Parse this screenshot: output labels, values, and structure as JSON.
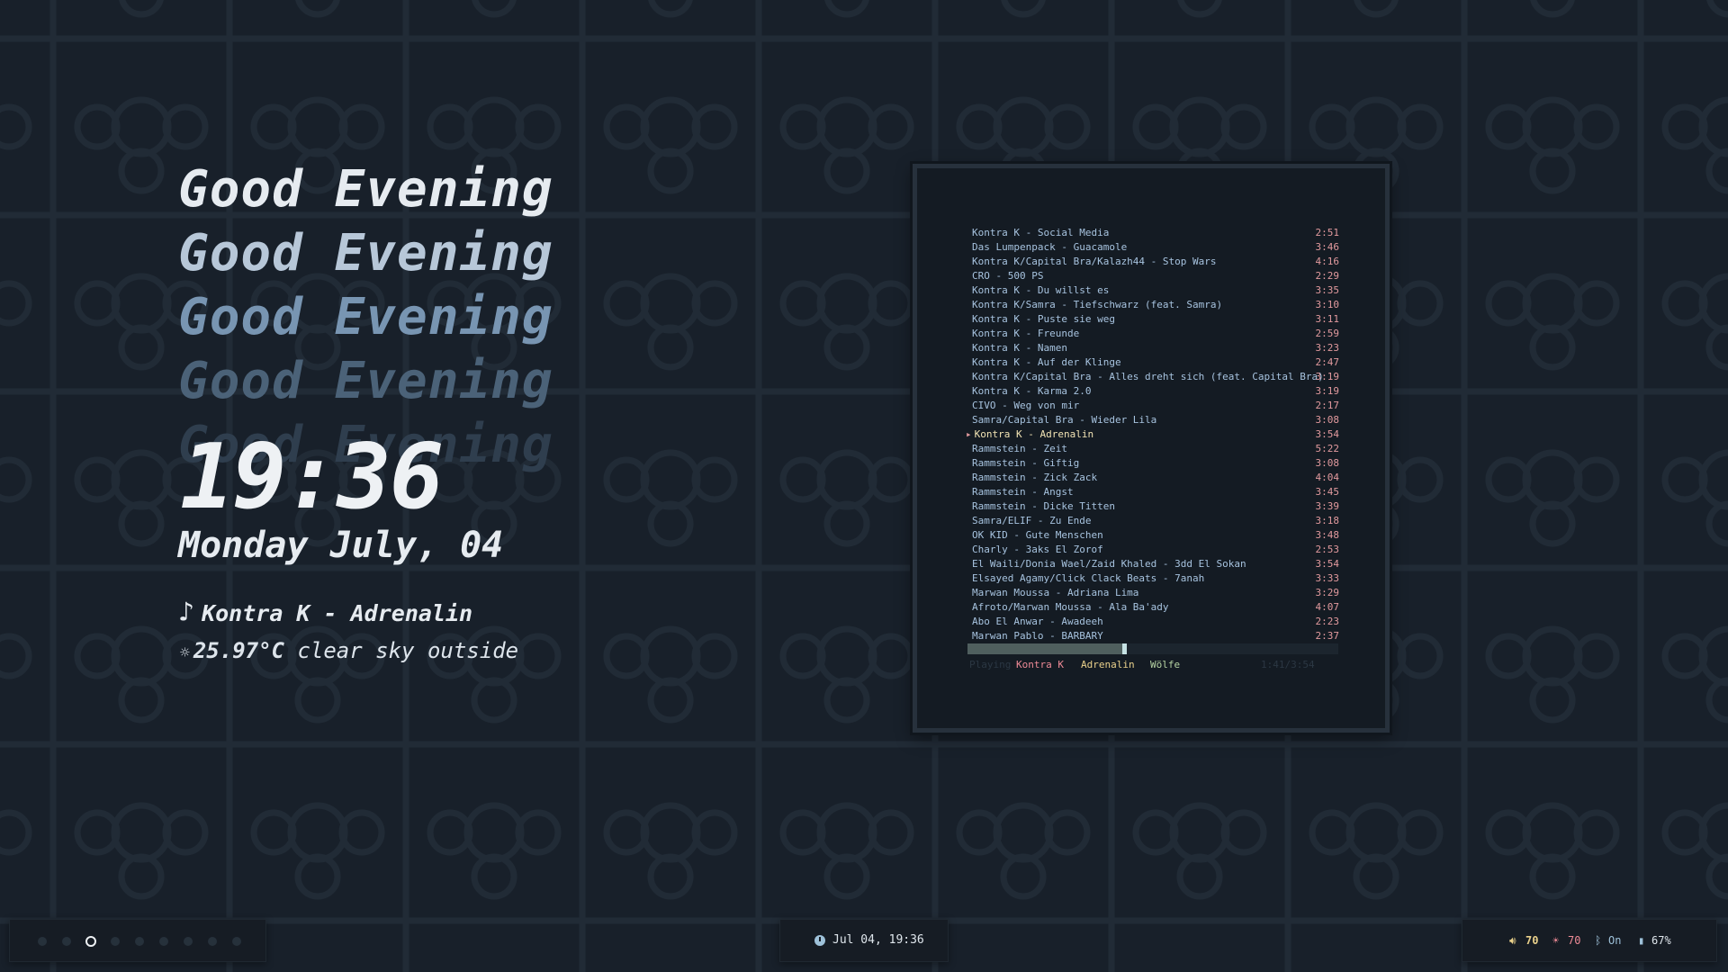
{
  "greeting": {
    "lines": [
      "Good Evening",
      "Good Evening",
      "Good Evening",
      "Good Evening",
      "Good Evening"
    ]
  },
  "clock": {
    "time": "19:36",
    "date": "Monday July, 04"
  },
  "now_playing": {
    "icon": "music-note-icon",
    "note_glyph": "♪",
    "text": "Kontra K - Adrenalin"
  },
  "weather": {
    "icon": "sun-icon",
    "icon_glyph": "☼",
    "temperature": "25.97°C",
    "description": "clear sky outside"
  },
  "player": {
    "tracks": [
      {
        "title": "Kontra K - Social Media",
        "duration": "2:51"
      },
      {
        "title": "Das Lumpenpack - Guacamole",
        "duration": "3:46"
      },
      {
        "title": "Kontra K/Capital Bra/Kalazh44 - Stop Wars",
        "duration": "4:16"
      },
      {
        "title": "CRO - 500 PS",
        "duration": "2:29"
      },
      {
        "title": "Kontra K - Du willst es",
        "duration": "3:35"
      },
      {
        "title": "Kontra K/Samra - Tiefschwarz (feat. Samra)",
        "duration": "3:10"
      },
      {
        "title": "Kontra K - Puste sie weg",
        "duration": "3:11"
      },
      {
        "title": "Kontra K - Freunde",
        "duration": "2:59"
      },
      {
        "title": "Kontra K - Namen",
        "duration": "3:23"
      },
      {
        "title": "Kontra K - Auf der Klinge",
        "duration": "2:47"
      },
      {
        "title": "Kontra K/Capital Bra - Alles dreht sich (feat. Capital Bra)",
        "duration": "3:19"
      },
      {
        "title": "Kontra K - Karma 2.0",
        "duration": "3:19"
      },
      {
        "title": "CIVO - Weg von mir",
        "duration": "2:17"
      },
      {
        "title": "Samra/Capital Bra - Wieder Lila",
        "duration": "3:08"
      },
      {
        "title": "Kontra K - Adrenalin",
        "duration": "3:54",
        "current": true
      },
      {
        "title": "Rammstein - Zeit",
        "duration": "5:22"
      },
      {
        "title": "Rammstein - Giftig",
        "duration": "3:08"
      },
      {
        "title": "Rammstein - Zick Zack",
        "duration": "4:04"
      },
      {
        "title": "Rammstein - Angst",
        "duration": "3:45"
      },
      {
        "title": "Rammstein - Dicke Titten",
        "duration": "3:39"
      },
      {
        "title": "Samra/ELIF - Zu Ende",
        "duration": "3:18"
      },
      {
        "title": "OK KID - Gute Menschen",
        "duration": "3:48"
      },
      {
        "title": "Charly - 3aks El Zorof",
        "duration": "2:53"
      },
      {
        "title": "El Waili/Donia Wael/Zaid Khaled - 3dd El Sokan",
        "duration": "3:54"
      },
      {
        "title": "Elsayed Agamy/Click Clack Beats - 7anah",
        "duration": "3:33"
      },
      {
        "title": "Marwan Moussa - Adriana Lima",
        "duration": "3:29"
      },
      {
        "title": "Afroto/Marwan Moussa - Ala Ba'ady",
        "duration": "4:07"
      },
      {
        "title": "Abo El Anwar - Awadeeh",
        "duration": "2:23"
      },
      {
        "title": "Marwan Pablo - BARBARY",
        "duration": "2:37"
      }
    ],
    "current_marker": "▸",
    "progress": 0.43,
    "status": {
      "left_dim": "Playing",
      "artist": "Kontra K",
      "title": "Adrenalin",
      "album": "Wölfe",
      "right_dim": "1:41/3:54"
    },
    "colors": {
      "track_text": "#a7c3df",
      "duration": "#e29a9e",
      "artist": "#ee8a96",
      "title": "#e9d08b",
      "album": "#b6d3a3"
    }
  },
  "workspaces": {
    "count": 9,
    "active_index": 2
  },
  "bar_clock": {
    "icon": "clock-icon",
    "text": "Jul 04, 19:36"
  },
  "system": {
    "volume": {
      "icon": "volume-icon",
      "glyph": "🔊︎",
      "value": "70"
    },
    "brightness": {
      "icon": "brightness-icon",
      "glyph": "☀",
      "value": "70"
    },
    "bluetooth": {
      "icon": "bluetooth-icon",
      "glyph": "ᛒ",
      "value": "On"
    },
    "battery": {
      "icon": "battery-icon",
      "glyph": "▮",
      "value": "67%"
    }
  }
}
